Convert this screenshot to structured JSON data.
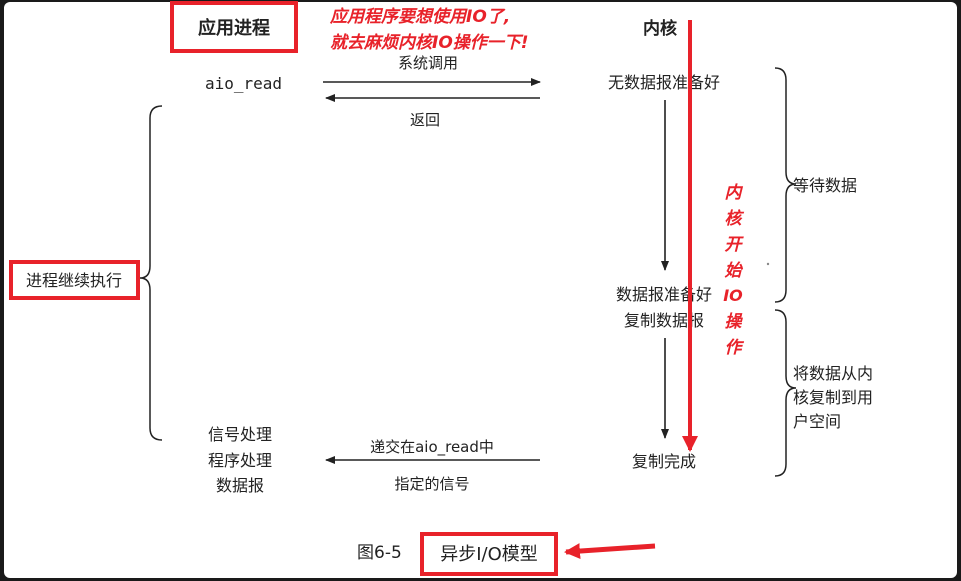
{
  "header": {
    "app_process": "应用进程",
    "kernel": "内核"
  },
  "annotations": {
    "top_line1": "应用程序要想使用IO了,",
    "top_line2": "就去麻烦内核IO操作一下!",
    "kernel_vertical": [
      "内",
      "核",
      "开",
      "始",
      "IO",
      "操",
      "作"
    ]
  },
  "calls": {
    "aio_read": "aio_read",
    "syscall": "系统调用",
    "return": "返回",
    "deliver_signal": "递交在aio_read中",
    "specified_signal": "指定的信号"
  },
  "kernel_states": {
    "no_data": "无数据报准备好",
    "data_ready": "数据报准备好",
    "copy_datagram": "复制数据报",
    "copy_done": "复制完成"
  },
  "phases": {
    "wait_data": "等待数据",
    "copy_line1": "将数据从内",
    "copy_line2": "核复制到用",
    "copy_line3": "户空间"
  },
  "app_side": {
    "continue": "进程继续执行",
    "handler_line1": "信号处理",
    "handler_line2": "程序处理",
    "handler_line3": "数据报"
  },
  "caption": {
    "figure_no": "图6-5",
    "title": "异步I/O模型"
  },
  "colors": {
    "accent_red": "#e8222a",
    "panel": "#ffffff",
    "frame": "#1a1a1a"
  }
}
